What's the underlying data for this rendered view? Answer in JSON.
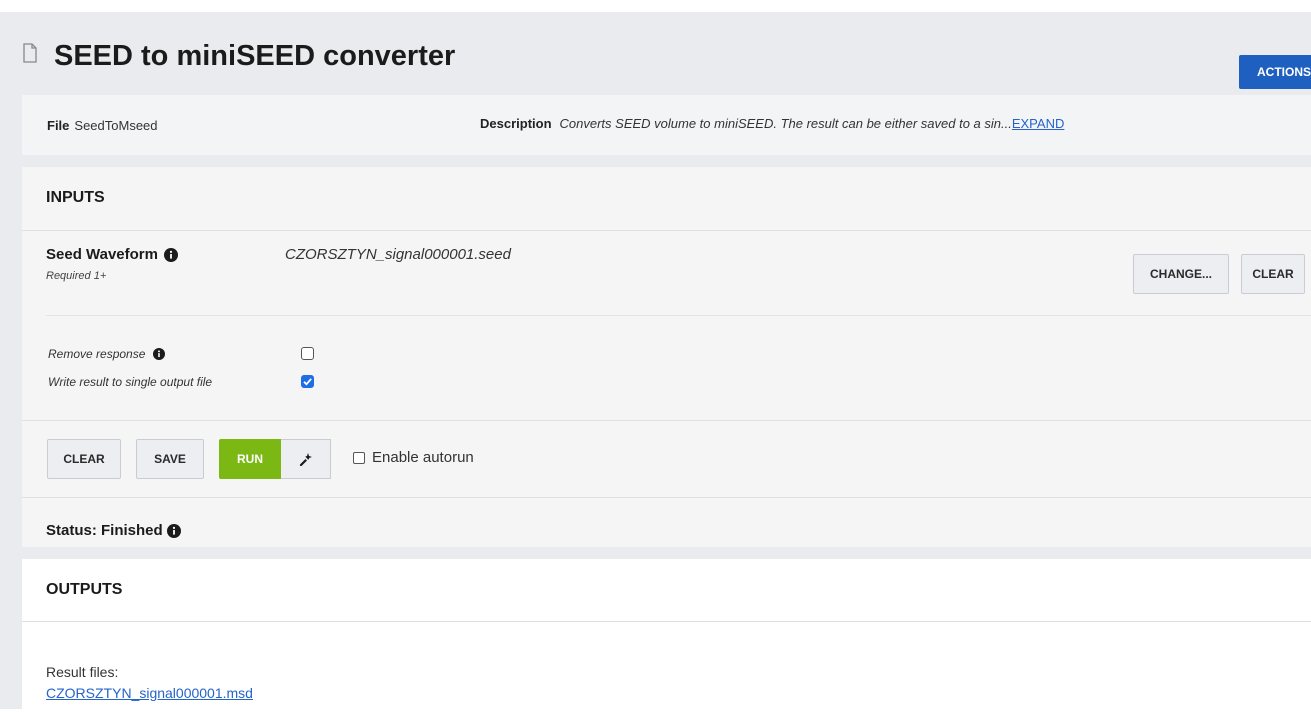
{
  "header": {
    "title": "SEED to miniSEED converter",
    "actions_label": "ACTIONS"
  },
  "info": {
    "file_label": "File",
    "file_value": "SeedToMseed",
    "description_label": "Description",
    "description_value": "Converts SEED volume to miniSEED. The result can be either saved to a sin...",
    "expand_label": "EXPAND"
  },
  "inputs": {
    "title": "INPUTS",
    "seed_waveform": {
      "label": "Seed Waveform",
      "required": "Required 1+",
      "value": "CZORSZTYN_signal000001.seed",
      "change_label": "CHANGE...",
      "clear_label": "CLEAR"
    },
    "options": [
      {
        "label": "Remove response",
        "checked": false,
        "has_info": true
      },
      {
        "label": "Write result to single output file",
        "checked": true,
        "has_info": false
      }
    ],
    "actions": {
      "clear_label": "CLEAR",
      "save_label": "SAVE",
      "run_label": "RUN",
      "autorun_label": "Enable autorun"
    },
    "status": "Status: Finished"
  },
  "outputs": {
    "title": "OUTPUTS",
    "result_label": "Result files:",
    "result_file": "CZORSZTYN_signal000001.msd"
  },
  "colors": {
    "accent_blue": "#1f5fbf",
    "run_green": "#7bb813",
    "link_blue": "#2563c9",
    "checkbox_blue": "#1e6fe6"
  }
}
